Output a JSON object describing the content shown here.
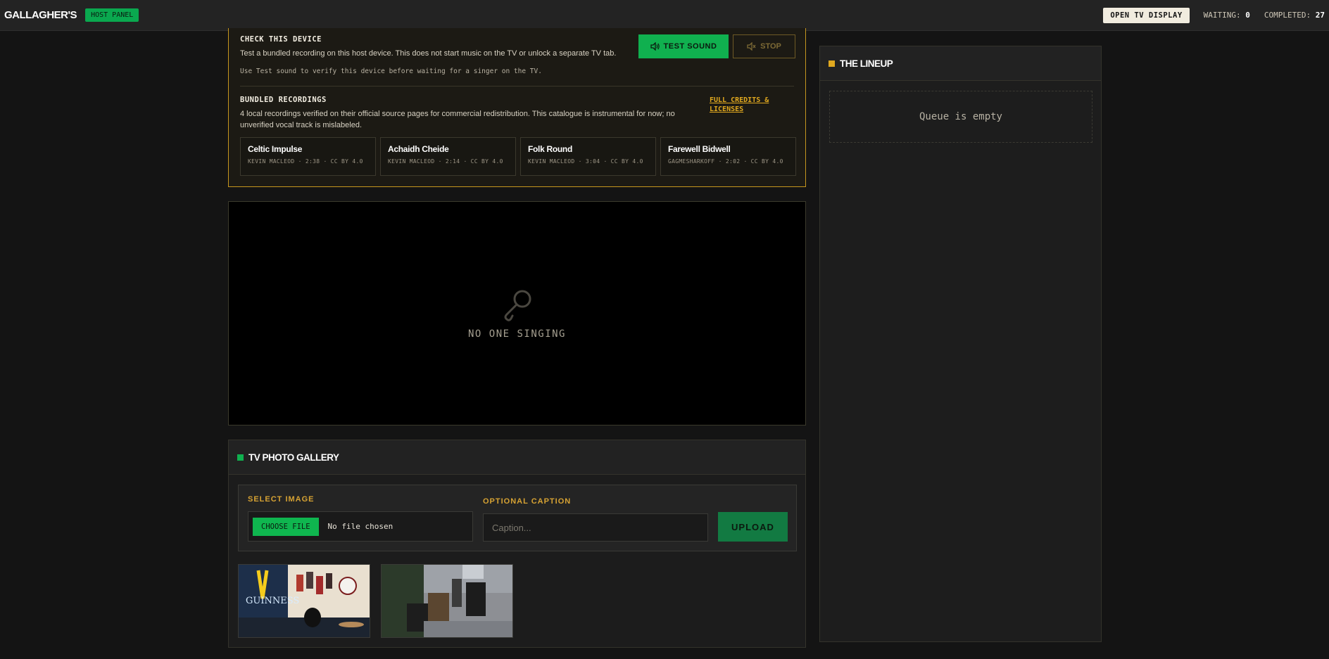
{
  "header": {
    "brand": "GALLAGHER'S",
    "badge": "HOST PANEL",
    "open_tv_label": "OPEN TV DISPLAY",
    "waiting_label": "WAITING:",
    "waiting_count": "0",
    "completed_label": "COMPLETED:",
    "completed_count": "27"
  },
  "device_check": {
    "title": "CHECK THIS DEVICE",
    "description": "Test a bundled recording on this host device. This does not start music on the TV or unlock a separate TV tab.",
    "hint": "Use Test sound to verify this device before waiting for a singer on the TV.",
    "test_button": "TEST SOUND",
    "stop_button": "STOP",
    "bundled_title": "BUNDLED RECORDINGS",
    "bundled_description": "4 local recordings verified on their official source pages for commercial redistribution. This catalogue is instrumental for now; no unverified vocal track is mislabeled.",
    "credits_link": "FULL CREDITS & LICENSES",
    "tracks": [
      {
        "title": "Celtic Impulse",
        "meta": "KEVIN MACLEOD · 2:38 · CC BY 4.0"
      },
      {
        "title": "Achaidh Cheide",
        "meta": "KEVIN MACLEOD · 2:14 · CC BY 4.0"
      },
      {
        "title": "Folk Round",
        "meta": "KEVIN MACLEOD · 3:04 · CC BY 4.0"
      },
      {
        "title": "Farewell Bidwell",
        "meta": "GAGMESHARKOFF · 2:02 · CC BY 4.0"
      }
    ]
  },
  "stage": {
    "status": "NO ONE SINGING",
    "icon": "microphone-icon"
  },
  "gallery": {
    "title": "TV PHOTO GALLERY",
    "select_label": "SELECT IMAGE",
    "choose_file": "CHOOSE FILE",
    "no_file": "No file chosen",
    "caption_label": "OPTIONAL CAPTION",
    "caption_placeholder": "Caption...",
    "upload_button": "UPLOAD",
    "photos": [
      {
        "name": "pub-interior-photo",
        "overlay_text": "GUINNESS"
      },
      {
        "name": "pub-exterior-photo",
        "overlay_text": ""
      }
    ]
  },
  "lineup": {
    "title": "THE LINEUP",
    "empty_text": "Queue is empty"
  },
  "colors": {
    "accent_green": "#10b04f",
    "accent_gold": "#e0a81f",
    "background": "#141414"
  }
}
